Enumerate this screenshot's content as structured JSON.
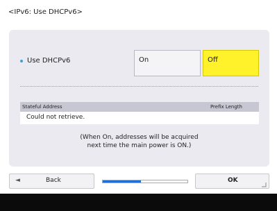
{
  "header": {
    "title": "<IPv6: Use DHCPv6>"
  },
  "setting": {
    "label": "Use DHCPv6",
    "options": [
      {
        "label": "On",
        "selected": false
      },
      {
        "label": "Off",
        "selected": true
      }
    ]
  },
  "table": {
    "columns": [
      "Stateful Address",
      "Prefix Length"
    ],
    "rows": [
      [
        "Could not retrieve."
      ]
    ]
  },
  "note": {
    "line1": "(When On, addresses will be acquired",
    "line2": "next time the main power is ON.)"
  },
  "footer_bar": {
    "back_label": "Back",
    "ok_label": "OK",
    "progress_fraction": 0.45
  },
  "colors": {
    "selected_option": "#fff22a",
    "progress_fill": "#1f6fd0",
    "bullet": "#3aa0d8"
  },
  "icons": {
    "back": "left-arrow-icon",
    "ok_corner": "corner-arrow-icon"
  }
}
